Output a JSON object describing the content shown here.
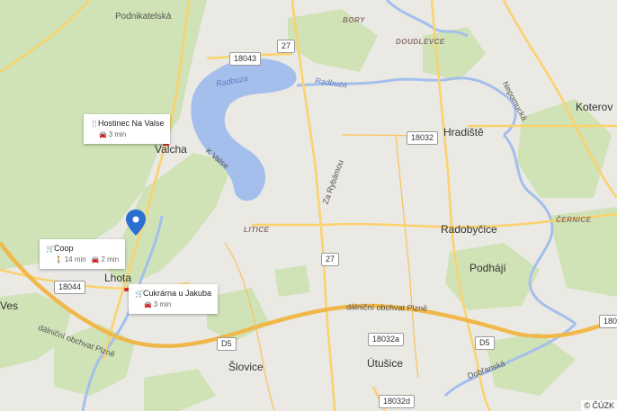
{
  "places": {
    "podnikatelska": "Podnikatelská",
    "bory": "BORY",
    "doudlevce": "DOUDLEVCE",
    "koterov": "Koterov",
    "hradiste": "Hradiště",
    "valcha": "Valcha",
    "k_valse": "K Valse",
    "litice": "LITICE",
    "cernice": "ČERNICE",
    "radobycice": "Radobyčice",
    "podhaji": "Podhájí",
    "lhota": "Lhota",
    "ves": "Ves",
    "slovice": "Šlovice",
    "utusice": "Útušice",
    "za_rybamou": "Za Rybámou",
    "nepomucka": "Nepomucká",
    "dobrzanska": "Dobřanská",
    "radbuza_lake": "Radbuza",
    "radbuza_river": "Radbuza",
    "obchvat_west": "dálniční obchvat Plzně",
    "obchvat_east": "dálniční obchvat Plzně"
  },
  "road_shields": {
    "r27_top": "27",
    "r18043": "18043",
    "r18032": "18032",
    "r27_mid": "27",
    "r18044": "18044",
    "d5_left": "D5",
    "d5_right": "D5",
    "r18032a": "18032a",
    "r18032d": "18032d",
    "r180_edge": "180"
  },
  "pois": [
    {
      "name": "Hostinec Na Valse",
      "icon": "restaurant-icon",
      "travel": [
        {
          "mode": "car-icon",
          "time": "3 min"
        }
      ]
    },
    {
      "name": "Coop",
      "icon": "shopping-cart-icon",
      "travel": [
        {
          "mode": "walk-icon",
          "time": "14 min"
        },
        {
          "mode": "car-icon",
          "time": "2 min"
        }
      ]
    },
    {
      "name": "Cukrárna u Jakuba",
      "icon": "shopping-cart-icon",
      "travel": [
        {
          "mode": "car-icon",
          "time": "3 min"
        }
      ]
    }
  ],
  "marker": {
    "icon": "location-pin-icon",
    "color": "#2a6fd1"
  },
  "colors": {
    "land": "#ebe9e4",
    "green": "#cfe3b6",
    "water": "#a5bfec",
    "road": "#fbd26c",
    "highway": "#f8c25a"
  },
  "copyright": "© ČÚZK"
}
